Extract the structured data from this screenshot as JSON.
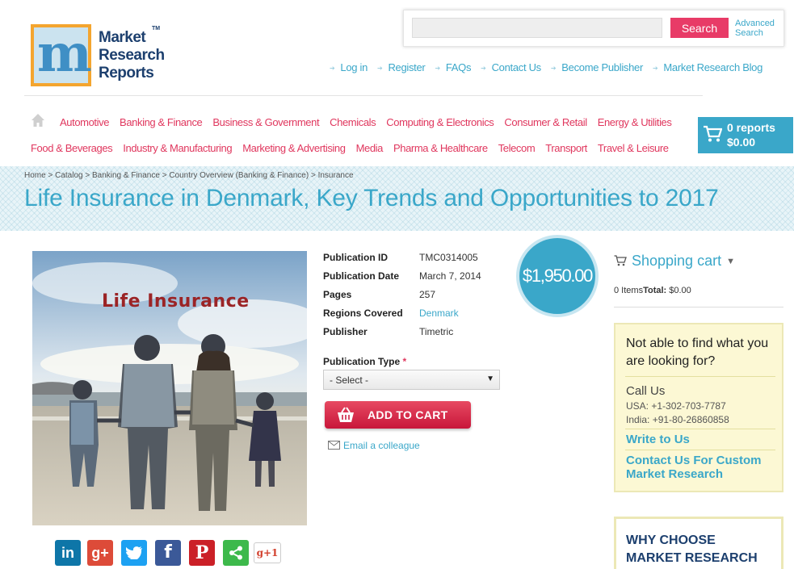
{
  "logo": {
    "line1": "Market",
    "line2": "Research",
    "line3": "Reports",
    "tm": "TM",
    "letter": "m"
  },
  "search": {
    "placeholder": "",
    "button": "Search",
    "advanced": "Advanced Search"
  },
  "toplinks": [
    "Log in",
    "Register",
    "FAQs",
    "Contact Us",
    "Become Publisher",
    "Market Research Blog"
  ],
  "categories_row1": [
    "Automotive",
    "Banking & Finance",
    "Business & Government",
    "Chemicals",
    "Computing & Electronics",
    "Consumer & Retail",
    "Energy & Utilities"
  ],
  "categories_row2": [
    "Food & Beverages",
    "Industry & Manufacturing",
    "Marketing & Advertising",
    "Media",
    "Pharma & Healthcare",
    "Telecom",
    "Transport",
    "Travel & Leisure"
  ],
  "cart": {
    "count": "0 reports",
    "total": "$0.00"
  },
  "breadcrumb": [
    "Home",
    "Catalog",
    "Banking & Finance",
    "Country Overview (Banking & Finance)",
    "Insurance"
  ],
  "breadcrumb_sep": ">",
  "page_title": "Life Insurance in Denmark, Key Trends and Opportunities to 2017",
  "product_image": {
    "title": "Life Insurance"
  },
  "details": [
    {
      "label": "Publication ID",
      "value": "TMC0314005"
    },
    {
      "label": "Publication Date",
      "value": "March 7, 2014"
    },
    {
      "label": "Pages",
      "value": "257"
    },
    {
      "label": "Regions Covered",
      "value": "Denmark"
    },
    {
      "label": "Publisher",
      "value": "Timetric"
    }
  ],
  "publication_type": {
    "label": "Publication Type",
    "required": "*",
    "selected": "- Select -"
  },
  "add_to_cart": "ADD TO CART",
  "email_colleague": "Email a colleague",
  "price": "$1,950.00",
  "shopping_cart": {
    "title": "Shopping cart",
    "items": "0 Items",
    "total_label": "Total:",
    "total": "$0.00"
  },
  "help": {
    "title": "Not able to find what you are looking for?",
    "call_us": "Call Us",
    "usa": "USA: +1-302-703-7787",
    "india": "India: +91-80-26860858",
    "write": "Write to Us",
    "custom": "Contact Us For Custom Market Research"
  },
  "why": {
    "line1": "WHY CHOOSE",
    "line2": "MARKET RESEARCH"
  },
  "social": {
    "gplus1": "g+1"
  },
  "colors": {
    "accent": "#3aa7c9",
    "pink": "#e0375e",
    "cart_red": "#c8163a",
    "help_bg": "#fcf8d4"
  }
}
